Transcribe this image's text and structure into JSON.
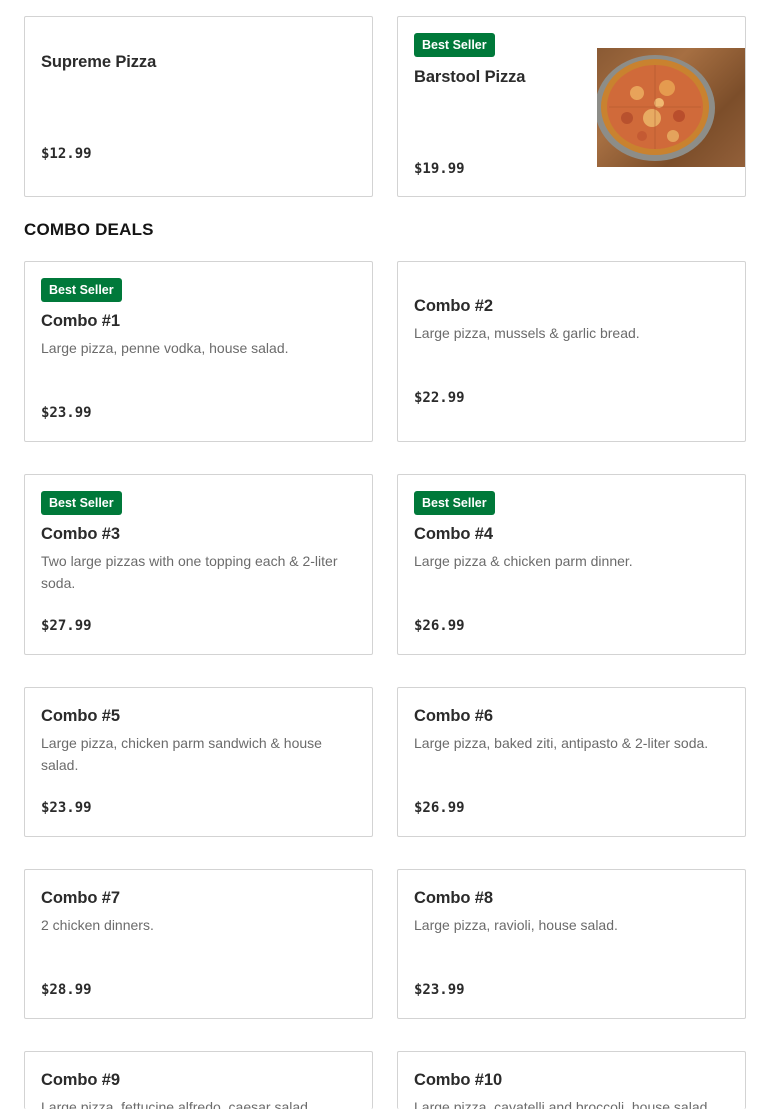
{
  "top_items": [
    {
      "title": "Supreme Pizza",
      "price": "$12.99"
    },
    {
      "badge": "Best Seller",
      "title": "Barstool Pizza",
      "price": "$19.99",
      "image_icon": "pizza-photo"
    }
  ],
  "section": {
    "title": "COMBO DEALS"
  },
  "combos": [
    {
      "badge": "Best Seller",
      "title": "Combo #1",
      "description": "Large pizza, penne vodka, house salad.",
      "price": "$23.99"
    },
    {
      "title": "Combo #2",
      "description": "Large pizza, mussels & garlic bread.",
      "price": "$22.99"
    },
    {
      "badge": "Best Seller",
      "title": "Combo #3",
      "description": "Two large pizzas with one topping each & 2-liter soda.",
      "price": "$27.99"
    },
    {
      "badge": "Best Seller",
      "title": "Combo #4",
      "description": "Large pizza & chicken parm dinner.",
      "price": "$26.99"
    },
    {
      "title": "Combo #5",
      "description": "Large pizza, chicken parm sandwich & house salad.",
      "price": "$23.99"
    },
    {
      "title": "Combo #6",
      "description": "Large pizza, baked ziti, antipasto & 2-liter soda.",
      "price": "$26.99"
    },
    {
      "title": "Combo #7",
      "description": "2 chicken dinners.",
      "price": "$28.99"
    },
    {
      "title": "Combo #8",
      "description": "Large pizza, ravioli, house salad.",
      "price": "$23.99"
    },
    {
      "title": "Combo #9",
      "description": "Large pizza, fettucine alfredo, caesar salad."
    },
    {
      "title": "Combo #10",
      "description": "Large pizza, cavatelli and broccoli, house salad."
    }
  ],
  "colors": {
    "badge_bg": "#00793a",
    "border": "#d3d3d3",
    "desc_text": "#6b6b6b"
  }
}
